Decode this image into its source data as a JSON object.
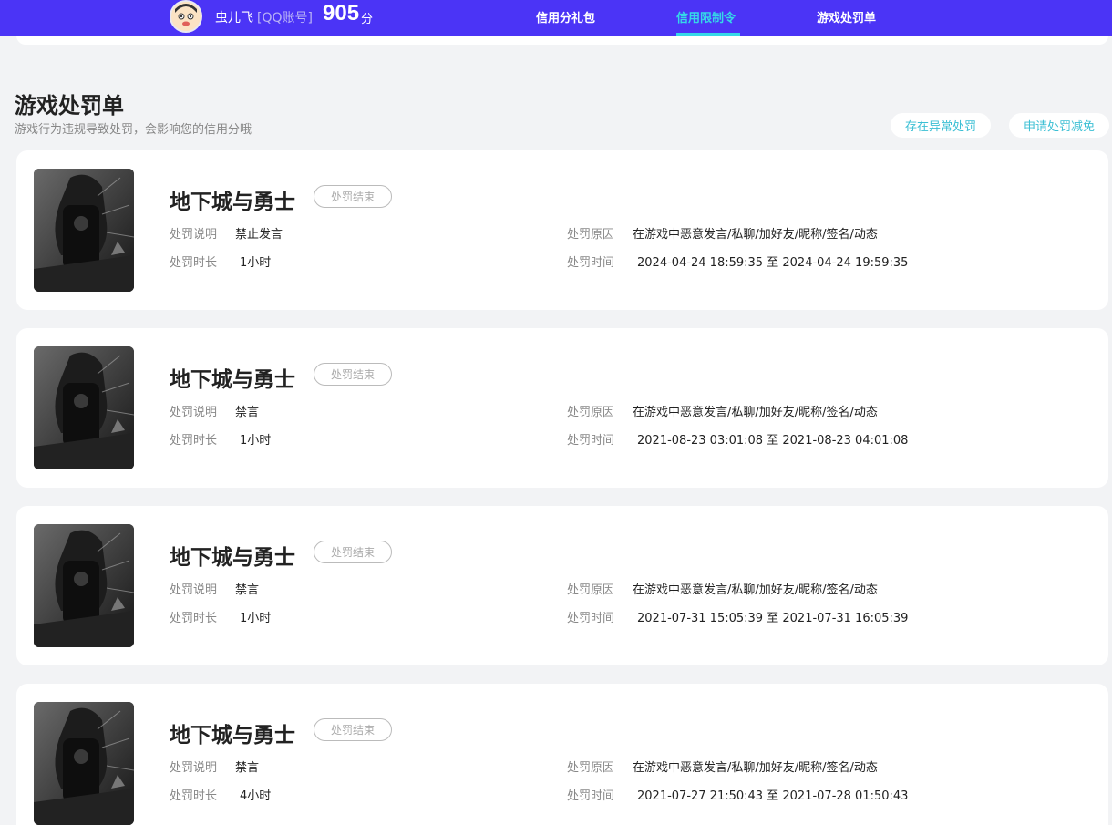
{
  "header": {
    "user_name": "虫儿飞",
    "account_type": "[QQ账号]",
    "score": "905",
    "score_unit": "分",
    "tabs": [
      {
        "label": "信用分礼包",
        "active": false
      },
      {
        "label": "信用限制令",
        "active": true
      },
      {
        "label": "游戏处罚单",
        "active": false
      }
    ]
  },
  "section": {
    "title": "游戏处罚单",
    "subtitle": "游戏行为违规导致处罚，会影响您的信用分哦",
    "report_button": "存在异常处罚",
    "reduce_button": "申请处罚减免"
  },
  "labels": {
    "desc": "处罚说明",
    "duration": "处罚时长",
    "reason": "处罚原因",
    "time": "处罚时间",
    "to": "至"
  },
  "penalties": [
    {
      "game": "地下城与勇士",
      "status": "处罚结束",
      "desc": "禁止发言",
      "duration": "1小时",
      "reason": "在游戏中恶意发言/私聊/加好友/昵称/签名/动态",
      "start": "2024-04-24 18:59:35",
      "end": "2024-04-24 19:59:35"
    },
    {
      "game": "地下城与勇士",
      "status": "处罚结束",
      "desc": "禁言",
      "duration": "1小时",
      "reason": "在游戏中恶意发言/私聊/加好友/昵称/签名/动态",
      "start": "2021-08-23 03:01:08",
      "end": "2021-08-23 04:01:08"
    },
    {
      "game": "地下城与勇士",
      "status": "处罚结束",
      "desc": "禁言",
      "duration": "1小时",
      "reason": "在游戏中恶意发言/私聊/加好友/昵称/签名/动态",
      "start": "2021-07-31 15:05:39",
      "end": "2021-07-31 16:05:39"
    },
    {
      "game": "地下城与勇士",
      "status": "处罚结束",
      "desc": "禁言",
      "duration": "4小时",
      "reason": "在游戏中恶意发言/私聊/加好友/昵称/签名/动态",
      "start": "2021-07-27 21:50:43",
      "end": "2021-07-28 01:50:43"
    }
  ]
}
